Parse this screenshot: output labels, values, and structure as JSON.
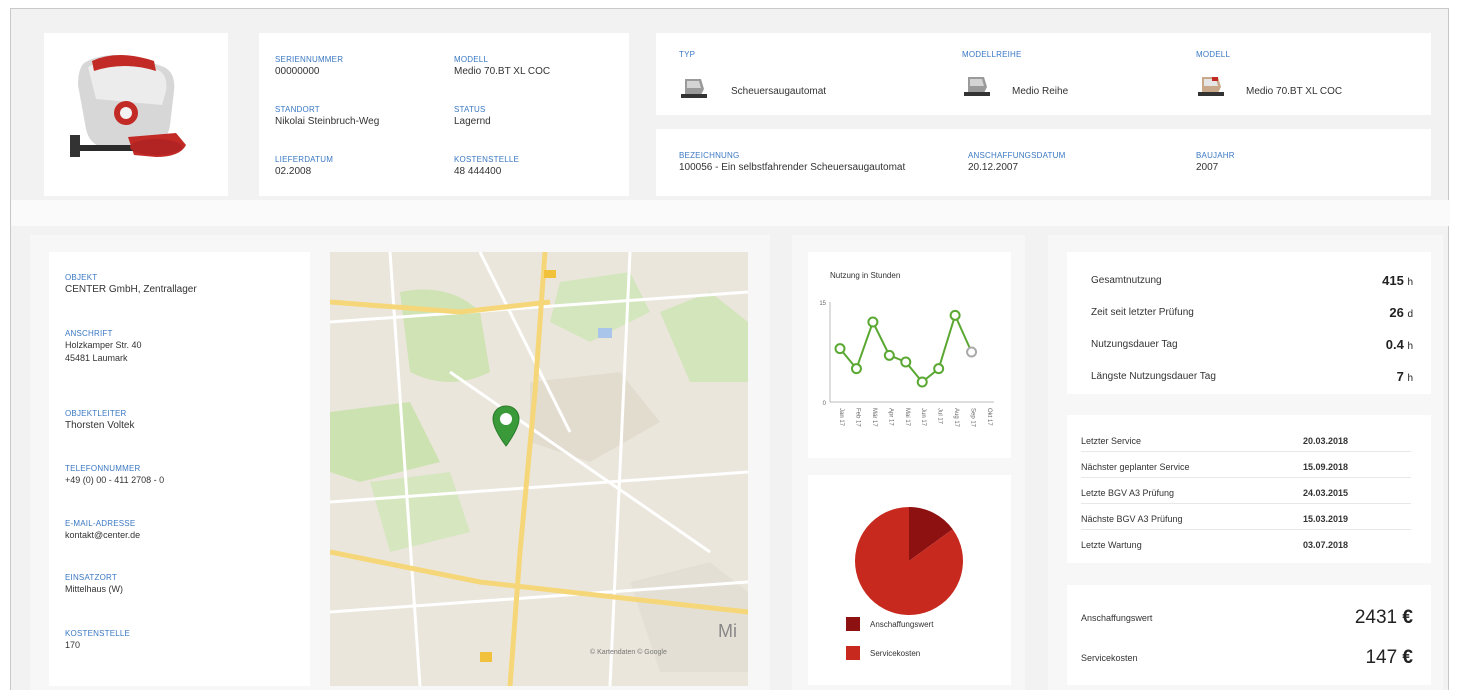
{
  "machine": {
    "fields": [
      {
        "label": "Seriennummer",
        "value": "00000000"
      },
      {
        "label": "Modell",
        "value": "Medio 70.BT XL COC"
      },
      {
        "label": "Standort",
        "value": "Nikolai Steinbruch-Weg"
      },
      {
        "label": "Status",
        "value": "Lagernd"
      },
      {
        "label": "Lieferdatum",
        "value": "02.2008"
      },
      {
        "label": "Kostenstelle",
        "value": "48 444400"
      }
    ]
  },
  "classification": {
    "items": [
      {
        "label": "Typ",
        "value": "Scheuersaugautomat",
        "icon": "scrubber-machine-icon"
      },
      {
        "label": "Modellreihe",
        "value": "Medio Reihe",
        "icon": "scrubber-machine-icon"
      },
      {
        "label": "Modell",
        "value": "Medio 70.BT XL COC",
        "icon": "scrubber-machine-icon"
      }
    ]
  },
  "acquisition": {
    "items": [
      {
        "label": "Bezeichnung",
        "value": "100056 - Ein selbstfahrender Scheuersaugautomat"
      },
      {
        "label": "Anschaffungsdatum",
        "value": "20.12.2007"
      },
      {
        "label": "Baujahr",
        "value": "2007"
      }
    ]
  },
  "contact": {
    "fields": [
      {
        "label": "Objekt",
        "lines": [
          "CENTER GmbH, Zentrallager"
        ]
      },
      {
        "label": "Anschrift",
        "lines": [
          "Holzkamper Str. 40",
          "45481 Laumark"
        ]
      },
      {
        "label": "Objektleiter",
        "lines": [
          "Thorsten Voltek"
        ]
      },
      {
        "label": "Telefonnummer",
        "lines": [
          "+49 (0) 00 - 411 2708 - 0"
        ]
      },
      {
        "label": "E-Mail-Adresse",
        "lines": [
          "kontakt@center.de"
        ]
      },
      {
        "label": "Einsatzort",
        "lines": [
          "Mittelhaus (W)"
        ]
      },
      {
        "label": "Kostenstelle",
        "lines": [
          "170"
        ]
      }
    ]
  },
  "map": {
    "corner_label": "Mi",
    "attribution": "© Kartendaten © Google"
  },
  "chart_data": [
    {
      "type": "line",
      "title": "Nutzung in Stunden",
      "categories": [
        "Jan 17",
        "Feb 17",
        "Mär 17",
        "Apr 17",
        "Mai 17",
        "Jun 17",
        "Jul 17",
        "Aug 17",
        "Sep 17",
        "Okt 17"
      ],
      "series": [
        {
          "values": [
            8,
            5,
            12,
            7,
            6,
            3,
            5,
            13,
            7.5,
            null
          ],
          "color": "#5aa832"
        }
      ],
      "ylim": [
        0,
        15
      ],
      "yticks": [
        0,
        15
      ],
      "last_point_grey": true
    },
    {
      "type": "pie",
      "slices": [
        {
          "name": "Anschaffungswert",
          "value": 15,
          "color": "#8e1111"
        },
        {
          "name": "Servicekosten",
          "value": 85,
          "color": "#c8291f"
        }
      ]
    }
  ],
  "metrics": [
    {
      "label": "Gesamtnutzung",
      "value": "415",
      "unit": "h"
    },
    {
      "label": "Zeit seit letzter Prüfung",
      "value": "26",
      "unit": "d"
    },
    {
      "label": "Nutzungsdauer Tag",
      "value": "0.4",
      "unit": "h"
    },
    {
      "label": "Längste Nutzungsdauer Tag",
      "value": "7",
      "unit": "h"
    }
  ],
  "dates": [
    {
      "label": "Letzter Service",
      "value": "20.03.2018"
    },
    {
      "label": "Nächster geplanter Service",
      "value": "15.09.2018"
    },
    {
      "label": "Letzte BGV A3 Prüfung",
      "value": "24.03.2015"
    },
    {
      "label": "Nächste BGV A3 Prüfung",
      "value": "15.03.2019"
    },
    {
      "label": "Letzte Wartung",
      "value": "03.07.2018"
    }
  ],
  "costs": [
    {
      "label": "Anschaffungswert",
      "value": "2431",
      "currency": "€"
    },
    {
      "label": "Servicekosten",
      "value": "147",
      "currency": "€"
    }
  ]
}
